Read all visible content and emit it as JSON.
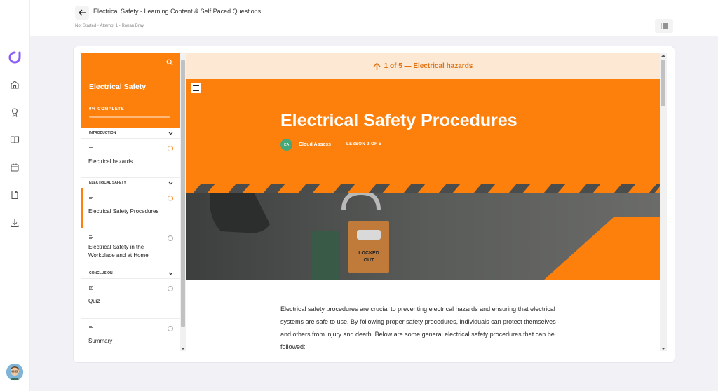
{
  "header": {
    "title": "Electrical Safety - Learning Content & Self Paced Questions",
    "subtitle": "Not Started • Attempt 1 - Ronan Bray"
  },
  "rail": {
    "icons": [
      "home-icon",
      "award-icon",
      "book-icon",
      "calendar-icon",
      "document-icon",
      "download-icon"
    ]
  },
  "sidebar": {
    "title": "Electrical Safety",
    "progress_label": "0% COMPLETE",
    "progress_percent": 0,
    "sections": [
      {
        "title": "INTRODUCTION",
        "lessons": [
          {
            "name": "Electrical hazards",
            "status": "in-progress"
          }
        ]
      },
      {
        "title": "ELECTRICAL SAFETY",
        "lessons": [
          {
            "name": "Electrical Safety Procedures",
            "status": "in-progress"
          },
          {
            "name": "Electrical Safety in the Workplace and at Home",
            "status": "not-started"
          }
        ]
      },
      {
        "title": "CONCLUSION",
        "lessons": [
          {
            "name": "Quiz",
            "status": "not-started"
          },
          {
            "name": "Summary",
            "status": "not-started"
          }
        ]
      }
    ]
  },
  "content": {
    "nav_label": "1 of 5 — Electrical hazards",
    "lesson_title": "Electrical Safety Procedures",
    "author_initials": "CA",
    "author_name": "Cloud Assess",
    "lesson_count": "LESSON 2 OF 5",
    "body": "Electrical safety procedures are crucial to preventing electrical hazards and ensuring that electrical systems are safe to use. By following proper safety procedures, individuals can protect themselves and others from injury and death. Below are some general electrical safety procedures that can be followed:",
    "tag_text_line1": "LOCKED",
    "tag_text_line2": "OUT"
  },
  "colors": {
    "accent": "#fd7f0c",
    "banner_bg": "#fde8d4",
    "banner_text": "#e07310"
  }
}
